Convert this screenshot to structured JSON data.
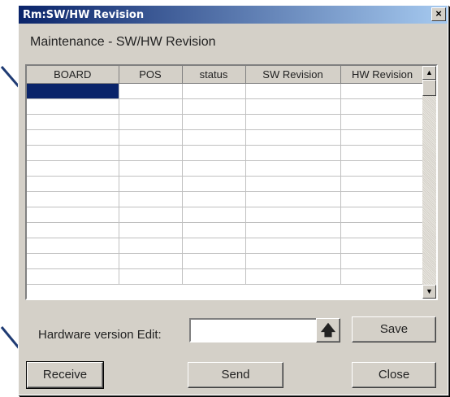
{
  "window": {
    "title": "Rm:SW/HW Revision",
    "close_glyph": "×"
  },
  "group_title": "Maintenance - SW/HW Revision",
  "table": {
    "columns": [
      "BOARD",
      "POS",
      "status",
      "SW Revision",
      "HW Revision"
    ],
    "row_count": 13,
    "selected_row": 0
  },
  "hw_edit": {
    "label": "Hardware version Edit:",
    "value": ""
  },
  "buttons": {
    "up_glyph": "🡅",
    "save": "Save",
    "receive": "Receive",
    "send": "Send",
    "close": "Close"
  },
  "colors": {
    "title_start": "#0a246a",
    "title_end": "#a6caf0",
    "selection": "#0a246a",
    "arrow": "#1f3b73"
  }
}
